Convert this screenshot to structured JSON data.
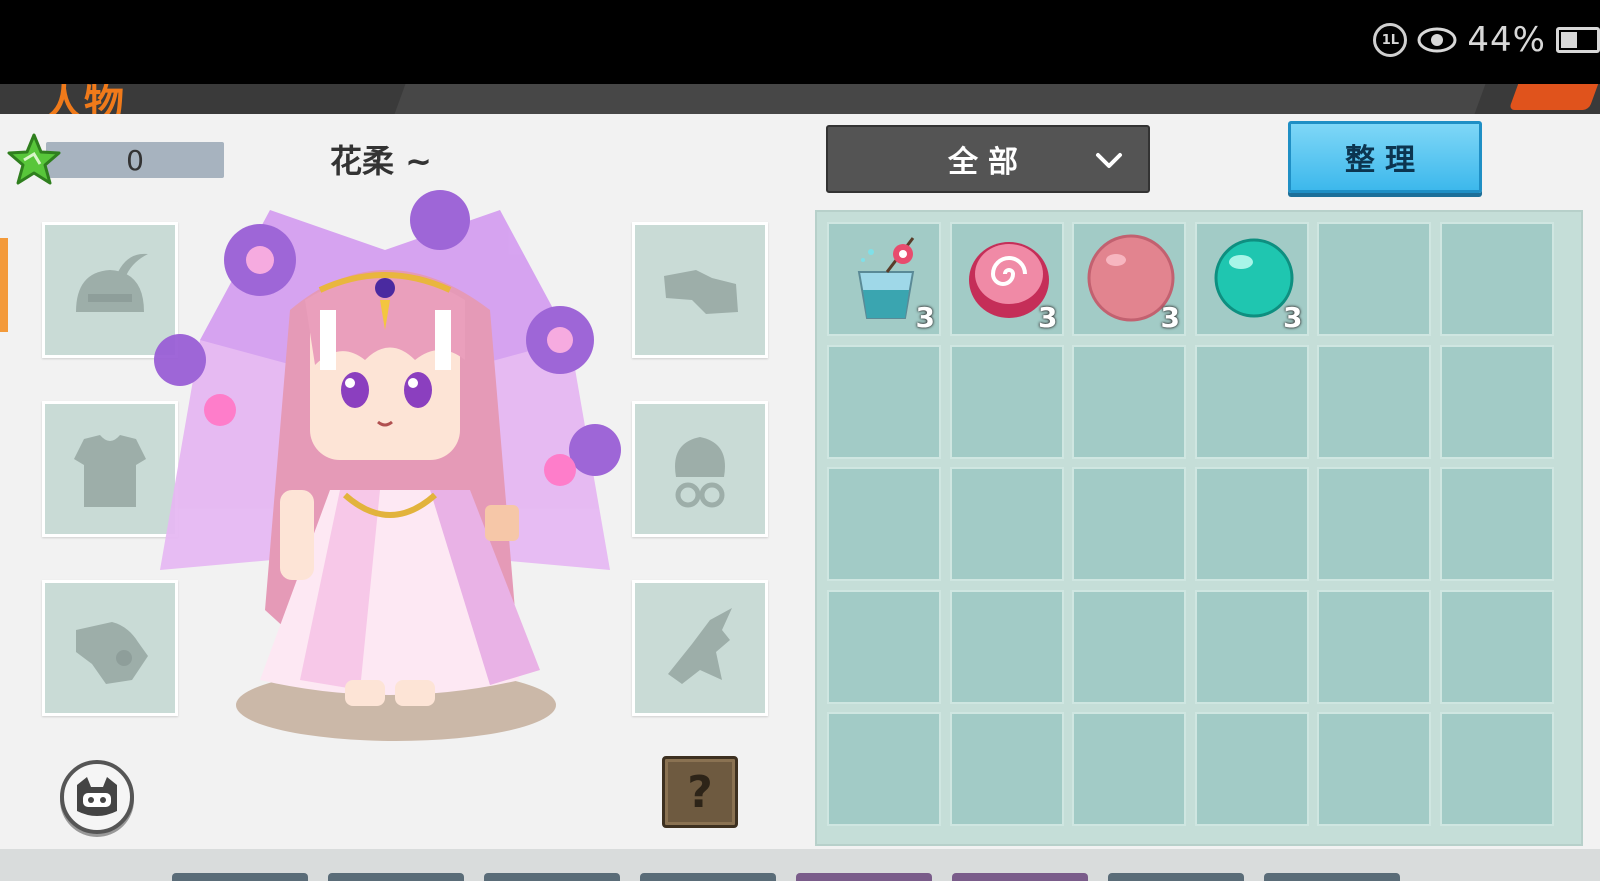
{
  "status_bar": {
    "battery_percent": "44%",
    "signal_label": "1L"
  },
  "header": {
    "title": "人物"
  },
  "player": {
    "star_count": "0",
    "character_name": "花柔 ~"
  },
  "filter": {
    "selected": "全部"
  },
  "toolbar": {
    "sort_label": "整理"
  },
  "help_button": {
    "label": "?"
  },
  "equipment_slots": [
    {
      "position": "left-top",
      "icon": "helmet-icon",
      "empty": true
    },
    {
      "position": "left-middle",
      "icon": "armor-icon",
      "empty": true
    },
    {
      "position": "left-bottom",
      "icon": "gloves-icon",
      "empty": true
    },
    {
      "position": "right-top",
      "icon": "boots-icon",
      "empty": true
    },
    {
      "position": "right-middle",
      "icon": "accessory-icon",
      "empty": true
    },
    {
      "position": "right-bottom",
      "icon": "mount-icon",
      "empty": true
    }
  ],
  "inventory": {
    "rows": 5,
    "cols": 6,
    "items": [
      {
        "name": "fruit-skewer-drink",
        "icon": "drink-icon",
        "quantity": "3"
      },
      {
        "name": "swirl-candy",
        "icon": "swirl-candy-icon",
        "quantity": "3"
      },
      {
        "name": "pink-ball",
        "icon": "pink-ball-icon",
        "quantity": "3"
      },
      {
        "name": "green-orb",
        "icon": "green-orb-icon",
        "quantity": "3"
      }
    ]
  },
  "colors": {
    "accent_orange": "#f07a1a",
    "sort_button": "#3db8ec",
    "inventory_cell": "#a2cbc6",
    "panel_bg": "#f2f2f2"
  }
}
